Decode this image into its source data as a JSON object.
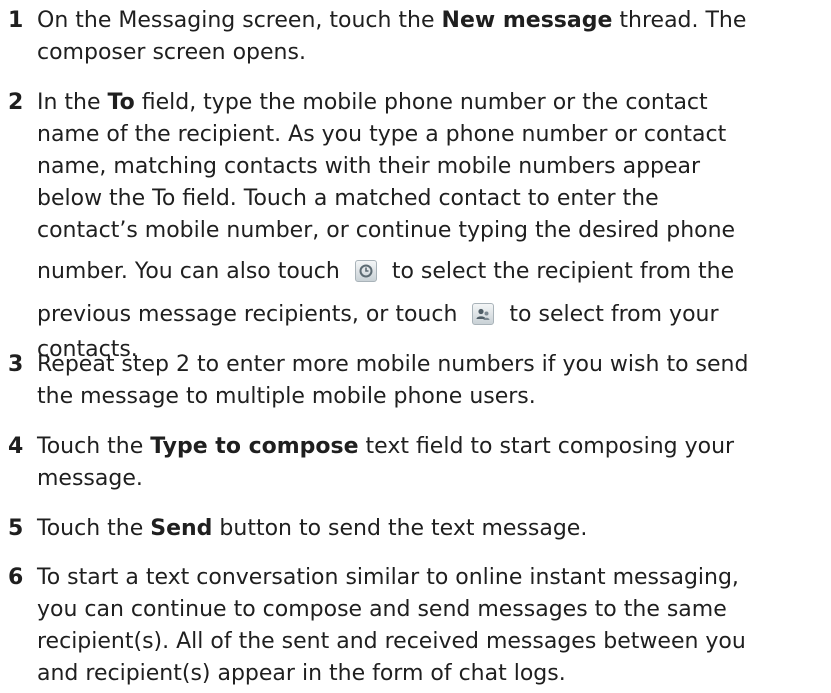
{
  "steps": [
    {
      "number": "1",
      "lines": [
        [
          "On the Messaging screen, touch the ",
          "New message",
          " thread. The"
        ],
        [
          "composer screen opens."
        ]
      ]
    },
    {
      "number": "2",
      "lines": [
        [
          "In the ",
          "To",
          " field, type the mobile phone number or the contact"
        ],
        [
          "name of the recipient. As you type a phone number or contact"
        ],
        [
          "matching contacts with their mobile numbers appear"
        ],
        [
          "below the To field. Touch a matched contact to enter the"
        ],
        [
          "contact’s mobile number, or continue typing the desired phone"
        ],
        [
          "number. You can also touch ",
          " to select the recipient from the"
        ],
        [
          "previous message recipients, or touch ",
          " to select from your"
        ],
        [
          "contacts."
        ]
      ],
      "line2_start": "name,"
    },
    {
      "number": "3",
      "lines": [
        [
          "Repeat step 2 to enter more mobile numbers if you wish to send"
        ],
        [
          "the message to multiple mobile phone users."
        ]
      ]
    },
    {
      "number": "4",
      "lines": [
        [
          "Touch the ",
          "Type to compose",
          " text field to start composing your"
        ],
        [
          "message."
        ]
      ]
    },
    {
      "number": "5",
      "lines": [
        [
          "Touch the ",
          "Send",
          " button to send the text message."
        ]
      ]
    },
    {
      "number": "6",
      "lines": [
        [
          "To start a text conversation similar to online instant messaging,"
        ],
        [
          "you can continue to compose and send messages to the same"
        ],
        [
          "recipient(s). All of the sent and received messages between you"
        ],
        [
          "and recipient(s) appear in the form of chat logs."
        ]
      ]
    }
  ],
  "icons": {
    "recent": "recent-recipients-icon",
    "contacts": "contacts-icon"
  }
}
